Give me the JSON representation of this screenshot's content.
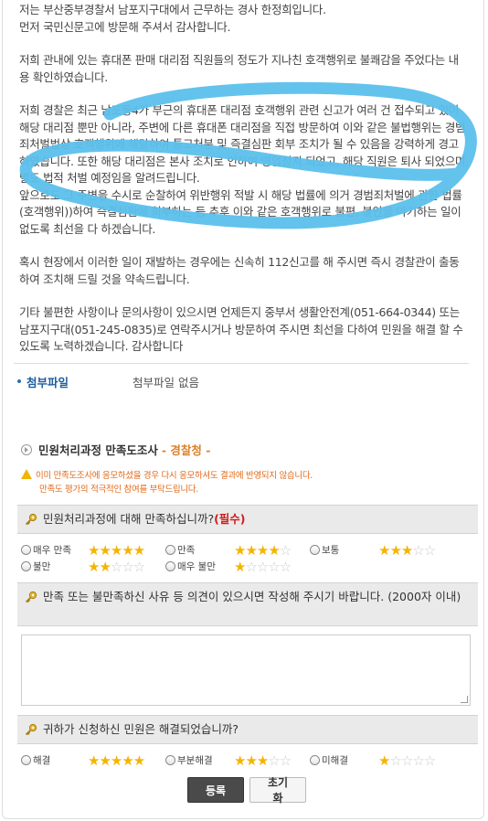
{
  "answer": {
    "paragraphs": [
      "저는 부산중부경찰서 남포지구대에서 근무하는 경사 한정희입니다.\n먼저 국민신문고에 방문해 주셔서 감사합니다.",
      "저희 관내에 있는 휴대폰 판매 대리점 직원들의 정도가 지나친 호객행위로 불쾌감을 주었다는 내용 확인하였습니다.",
      "저희 경찰은 최근 남포동4가 부근의 휴대폰 대리점 호객행위 관련 신고가 여러 건 접수되고 있어 해당 대리점 뿐만 아니라, 주변에 다른 휴대폰 대리점을 직접 방문하여 이와 같은 불법행위는 경범죄처벌법상 호객행위에 해당하여 통고처분 및 즉결심판 회부 조치가 될 수 있음을 강력하게 경고하였습니다. 또한 해당 대리점은 본사 조치로 인하여 영업정지 되었고, 해당 직원은 퇴사 되었으며, 별도 법적 처벌 예정임을 알려드립니다.\n앞으로도 그 주변을 수시로 순찰하여 위반행위 적발 시 해당 법률에 의거 경범죄처벌에 관한 법률(호객행위))하여 즉결심판에 회부하는 등 추후 이와 같은 호객행위로 불편, 불안을 야기하는 일이 없도록 최선을 다 하겠습니다.",
      "혹시 현장에서 이러한 일이 재발하는 경우에는 신속히 112신고를 해 주시면 즉시 경찰관이 출동하여 조치해 드릴 것을 약속드립니다.",
      "기타 불편한 사항이나 문의사항이 있으시면 언제든지 중부서 생활안전계(051-664-0344) 또는 남포지구대(051-245-0835)로 연락주시거나 방문하여 주시면 최선을 다하여 민원을 해결 할 수 있도록 노력하겠습니다. 감사합니다"
    ]
  },
  "attachment": {
    "label": "첨부파일",
    "value": "첨부파일 없음"
  },
  "survey": {
    "title": "민원처리과정 만족도조사",
    "org": "- 경찰청 -",
    "notice_line1": "이미 만족도조사에 응모하셨을 경우 다시 응모하셔도 결과에 반영되지 않습니다.",
    "notice_line2": "만족도 평가의 적극적인 참여를 부탁드립니다.",
    "q1": {
      "text": "민원처리과정에 대해 만족하십니까?",
      "required": "(필수)",
      "options": [
        {
          "label": "매우 만족",
          "stars": 5
        },
        {
          "label": "만족",
          "stars": 4
        },
        {
          "label": "보통",
          "stars": 3
        },
        {
          "label": "불만",
          "stars": 2
        },
        {
          "label": "매우 불만",
          "stars": 1
        }
      ]
    },
    "q2": {
      "text": "만족 또는 불만족하신 사유 등 의견이 있으시면 작성해 주시기 바랍니다. (2000자 이내)"
    },
    "q3": {
      "text": "귀하가 신청하신 민원은 해결되었습니까?",
      "options": [
        {
          "label": "해결",
          "stars": 5
        },
        {
          "label": "부분해결",
          "stars": 3
        },
        {
          "label": "미해결",
          "stars": 1
        }
      ]
    }
  },
  "buttons": {
    "submit": "등록",
    "reset": "초기화"
  },
  "colors": {
    "accent": "#1e5e9e",
    "org": "#d9822b",
    "required": "#d21a1a",
    "star": "#f5b400",
    "scribble": "#5bc0ec"
  }
}
